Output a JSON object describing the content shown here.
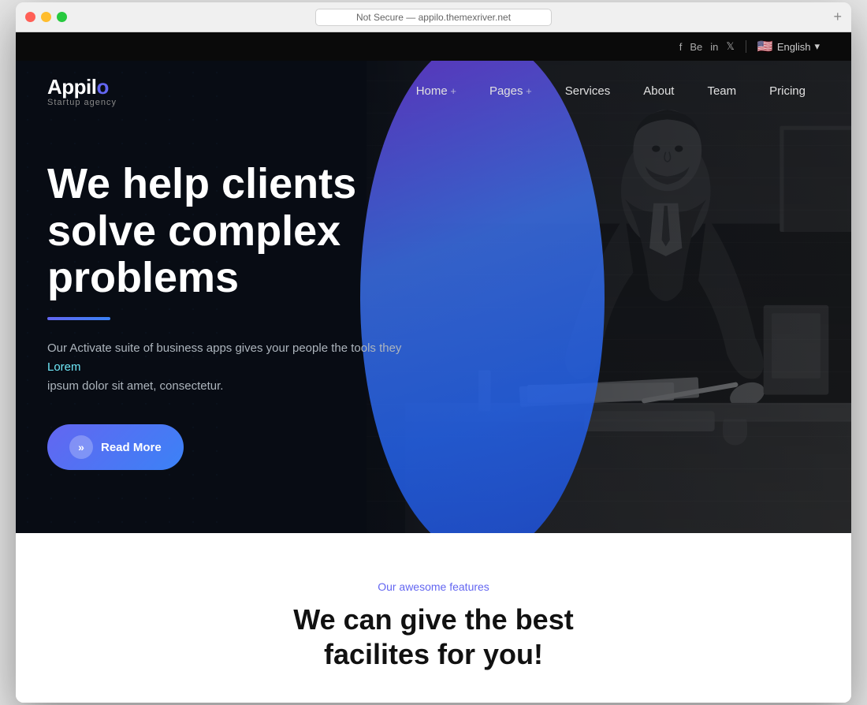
{
  "browser": {
    "url": "Not Secure — appilo.themexriver.net",
    "plus_label": "+"
  },
  "topbar": {
    "lang": "English",
    "social": [
      "f",
      "Be",
      "in",
      "🐦"
    ]
  },
  "logo": {
    "text_before_o": "Appil",
    "o_letter": "o",
    "subtitle": "Startup agency"
  },
  "nav": {
    "items": [
      {
        "label": "Home",
        "has_arrow": true
      },
      {
        "label": "Pages",
        "has_arrow": true
      },
      {
        "label": "Services",
        "has_arrow": false
      },
      {
        "label": "About",
        "has_arrow": false
      },
      {
        "label": "Team",
        "has_arrow": false
      },
      {
        "label": "Pricing",
        "has_arrow": false
      }
    ]
  },
  "hero": {
    "title": "We help clients solve complex problems",
    "description_line1": "Our Activate suite of business apps gives your people the tools they",
    "description_highlight": "Lorem",
    "description_line2": "ipsum dolor sit amet, consectetur.",
    "cta_label": "Read More"
  },
  "features": {
    "label": "Our awesome features",
    "title_line1": "We can give the best",
    "title_line2": "facilites for you!"
  },
  "colors": {
    "accent_purple": "#6366f1",
    "accent_blue": "#3b82f6",
    "hero_bg": "#080c14",
    "oval_top": "#6b35d4",
    "oval_bottom": "#2563eb"
  }
}
